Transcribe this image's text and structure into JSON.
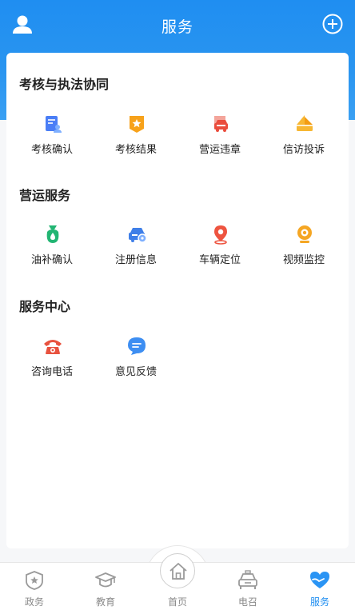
{
  "header": {
    "title": "服务"
  },
  "sections": [
    {
      "title": "考核与执法协同",
      "items": [
        {
          "label": "考核确认",
          "icon": "assessment-confirm-icon"
        },
        {
          "label": "考核结果",
          "icon": "assessment-result-icon"
        },
        {
          "label": "营运违章",
          "icon": "operation-violation-icon"
        },
        {
          "label": "信访投诉",
          "icon": "complaint-icon"
        }
      ]
    },
    {
      "title": "营运服务",
      "items": [
        {
          "label": "油补确认",
          "icon": "fuel-subsidy-icon"
        },
        {
          "label": "注册信息",
          "icon": "registration-icon"
        },
        {
          "label": "车辆定位",
          "icon": "location-icon"
        },
        {
          "label": "视频监控",
          "icon": "camera-icon"
        }
      ]
    },
    {
      "title": "服务中心",
      "items": [
        {
          "label": "咨询电话",
          "icon": "phone-icon"
        },
        {
          "label": "意见反馈",
          "icon": "feedback-icon"
        }
      ]
    }
  ],
  "tabs": [
    {
      "label": "政务",
      "icon": "government-icon"
    },
    {
      "label": "教育",
      "icon": "education-icon"
    },
    {
      "label": "首页",
      "icon": "home-icon"
    },
    {
      "label": "电召",
      "icon": "taxi-icon"
    },
    {
      "label": "服务",
      "icon": "heart-hand-icon",
      "active": true
    }
  ],
  "colors": {
    "primary": "#1f8ef1",
    "tab_inactive": "#8a8a8a"
  }
}
